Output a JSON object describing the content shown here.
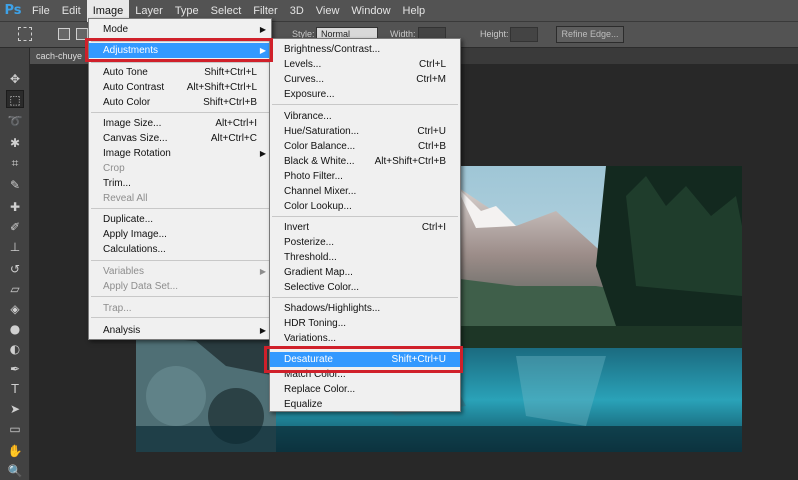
{
  "app": {
    "logo": "Ps"
  },
  "menubar": [
    "File",
    "Edit",
    "Image",
    "Layer",
    "Type",
    "Select",
    "Filter",
    "3D",
    "View",
    "Window",
    "Help"
  ],
  "active_menu": "Image",
  "options_bar": {
    "style_label": "Style:",
    "style_value": "Normal",
    "width_label": "Width:",
    "height_label": "Height:",
    "refine_edge": "Refine Edge..."
  },
  "document_tab": "cach-chuye",
  "image_menu": {
    "items": [
      {
        "label": "Mode",
        "shortcut": "",
        "submenu": true,
        "disabled": false
      },
      {
        "label": "Adjustments",
        "shortcut": "",
        "submenu": true,
        "disabled": false,
        "highlighted": true
      },
      {
        "label": "Auto Tone",
        "shortcut": "Shift+Ctrl+L"
      },
      {
        "label": "Auto Contrast",
        "shortcut": "Alt+Shift+Ctrl+L"
      },
      {
        "label": "Auto Color",
        "shortcut": "Shift+Ctrl+B"
      },
      {
        "label": "Image Size...",
        "shortcut": "Alt+Ctrl+I"
      },
      {
        "label": "Canvas Size...",
        "shortcut": "Alt+Ctrl+C"
      },
      {
        "label": "Image Rotation",
        "shortcut": "",
        "submenu": true
      },
      {
        "label": "Crop",
        "shortcut": "",
        "disabled": true
      },
      {
        "label": "Trim...",
        "shortcut": ""
      },
      {
        "label": "Reveal All",
        "shortcut": "",
        "disabled": true
      },
      {
        "label": "Duplicate...",
        "shortcut": ""
      },
      {
        "label": "Apply Image...",
        "shortcut": ""
      },
      {
        "label": "Calculations...",
        "shortcut": ""
      },
      {
        "label": "Variables",
        "shortcut": "",
        "submenu": true,
        "disabled": true
      },
      {
        "label": "Apply Data Set...",
        "shortcut": "",
        "disabled": true
      },
      {
        "label": "Trap...",
        "shortcut": "",
        "disabled": true
      },
      {
        "label": "Analysis",
        "shortcut": "",
        "submenu": true
      }
    ]
  },
  "adjustments_menu": {
    "items": [
      {
        "label": "Brightness/Contrast...",
        "shortcut": ""
      },
      {
        "label": "Levels...",
        "shortcut": "Ctrl+L"
      },
      {
        "label": "Curves...",
        "shortcut": "Ctrl+M"
      },
      {
        "label": "Exposure...",
        "shortcut": ""
      },
      {
        "label": "Vibrance...",
        "shortcut": ""
      },
      {
        "label": "Hue/Saturation...",
        "shortcut": "Ctrl+U"
      },
      {
        "label": "Color Balance...",
        "shortcut": "Ctrl+B"
      },
      {
        "label": "Black & White...",
        "shortcut": "Alt+Shift+Ctrl+B"
      },
      {
        "label": "Photo Filter...",
        "shortcut": ""
      },
      {
        "label": "Channel Mixer...",
        "shortcut": ""
      },
      {
        "label": "Color Lookup...",
        "shortcut": ""
      },
      {
        "label": "Invert",
        "shortcut": "Ctrl+I"
      },
      {
        "label": "Posterize...",
        "shortcut": ""
      },
      {
        "label": "Threshold...",
        "shortcut": ""
      },
      {
        "label": "Gradient Map...",
        "shortcut": ""
      },
      {
        "label": "Selective Color...",
        "shortcut": ""
      },
      {
        "label": "Shadows/Highlights...",
        "shortcut": ""
      },
      {
        "label": "HDR Toning...",
        "shortcut": ""
      },
      {
        "label": "Variations...",
        "shortcut": ""
      },
      {
        "label": "Desaturate",
        "shortcut": "Shift+Ctrl+U",
        "highlighted": true
      },
      {
        "label": "Match Color...",
        "shortcut": ""
      },
      {
        "label": "Replace Color...",
        "shortcut": ""
      },
      {
        "label": "Equalize",
        "shortcut": ""
      }
    ]
  },
  "colors": {
    "highlight": "#3399ff",
    "callout": "#d0202a",
    "ps_blue": "#3ea2e8"
  }
}
